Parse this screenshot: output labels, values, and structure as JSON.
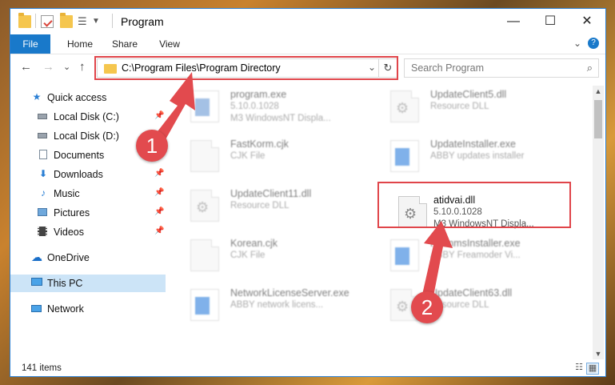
{
  "window": {
    "title": "Program"
  },
  "ribbon": {
    "tabs": [
      "File",
      "Home",
      "Share",
      "View"
    ],
    "help": "?"
  },
  "nav": {
    "back": "←",
    "forward": "→",
    "recent": "⌄",
    "up": "↑",
    "address": "C:\\Program Files\\Program Directory",
    "search_placeholder": "Search Program"
  },
  "sidebar": {
    "items": [
      {
        "label": "Quick access",
        "icon": "star-icon",
        "pinned": false
      },
      {
        "label": "Local Disk (C:)",
        "icon": "drive-icon",
        "pinned": true
      },
      {
        "label": "Local Disk (D:)",
        "icon": "drive-icon",
        "pinned": false
      },
      {
        "label": "Documents",
        "icon": "documents-icon",
        "pinned": true
      },
      {
        "label": "Downloads",
        "icon": "download-icon",
        "pinned": true
      },
      {
        "label": "Music",
        "icon": "music-icon",
        "pinned": true
      },
      {
        "label": "Pictures",
        "icon": "pictures-icon",
        "pinned": true
      },
      {
        "label": "Videos",
        "icon": "videos-icon",
        "pinned": true
      },
      {
        "label": "OneDrive",
        "icon": "cloud-icon",
        "pinned": false
      },
      {
        "label": "This PC",
        "icon": "computer-icon",
        "pinned": false
      },
      {
        "label": "Network",
        "icon": "network-icon",
        "pinned": false
      }
    ]
  },
  "files": [
    {
      "name": "program.exe",
      "line2": "5.10.0.1028",
      "line3": "M3 WindowsNT Displa...",
      "icon": "installer-icon"
    },
    {
      "name": "UpdateClient5.dll",
      "line2": "Resource DLL",
      "line3": "",
      "icon": "dll-icon"
    },
    {
      "name": "FastKorm.cjk",
      "line2": "CJK File",
      "line3": "",
      "icon": "file-icon"
    },
    {
      "name": "UpdateInstaller.exe",
      "line2": "ABBY updates installer",
      "line3": "",
      "icon": "exe-icon"
    },
    {
      "name": "UpdateClient11.dll",
      "line2": "Resource DLL",
      "line3": "",
      "icon": "dll-icon"
    },
    {
      "name": "atidvai.dll",
      "line2": "5.10.0.1028",
      "line3": "M3 WindowsNT Displa...",
      "icon": "gear-dll-icon"
    },
    {
      "name": "Korean.cjk",
      "line2": "CJK File",
      "line3": "",
      "icon": "file-icon"
    },
    {
      "name": "FrammsInstaller.exe",
      "line2": "ABBY Freamoder Vi...",
      "line3": "",
      "icon": "exe-icon"
    },
    {
      "name": "NetworkLicenseServer.exe",
      "line2": "ABBY network licens...",
      "line3": "",
      "icon": "exe-icon"
    },
    {
      "name": "UpdateClient63.dll",
      "line2": "Resource DLL",
      "line3": "",
      "icon": "dll-icon"
    }
  ],
  "status": {
    "count": "141 items"
  },
  "annotations": {
    "step1": "1",
    "step2": "2"
  },
  "colors": {
    "accent": "#1979ca",
    "highlight": "#e0454a",
    "selected": "#cce4f7"
  }
}
